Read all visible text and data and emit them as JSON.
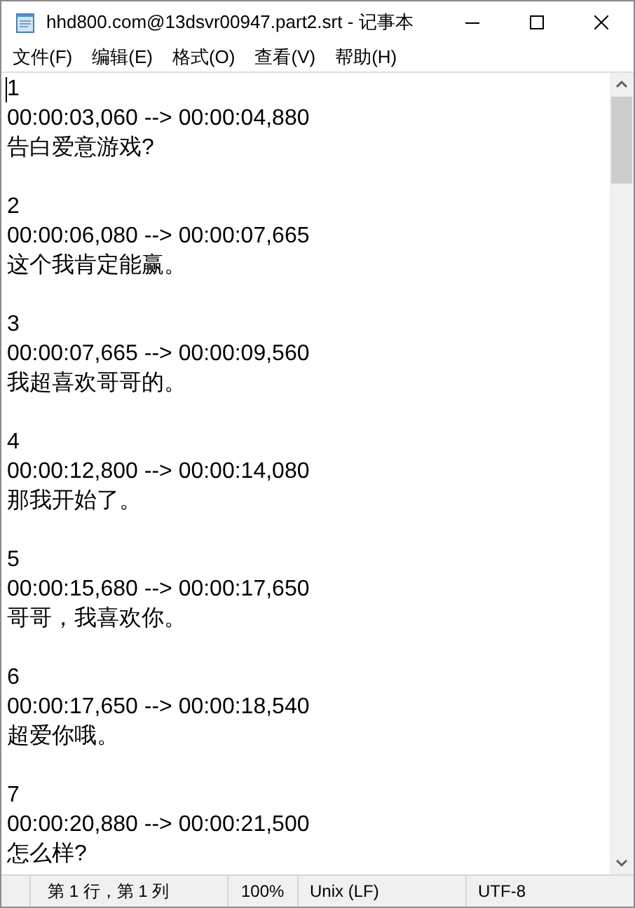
{
  "window": {
    "title": "hhd800.com@13dsvr00947.part2.srt - 记事本"
  },
  "menu": [
    "文件(F)",
    "编辑(E)",
    "格式(O)",
    "查看(V)",
    "帮助(H)"
  ],
  "subtitles": [
    {
      "index": "1",
      "time": "00:00:03,060 --> 00:00:04,880",
      "text": "告白爱意游戏?"
    },
    {
      "index": "2",
      "time": "00:00:06,080 --> 00:00:07,665",
      "text": "这个我肯定能赢。"
    },
    {
      "index": "3",
      "time": "00:00:07,665 --> 00:00:09,560",
      "text": "我超喜欢哥哥的。"
    },
    {
      "index": "4",
      "time": "00:00:12,800 --> 00:00:14,080",
      "text": "那我开始了。"
    },
    {
      "index": "5",
      "time": "00:00:15,680 --> 00:00:17,650",
      "text": "哥哥，我喜欢你。"
    },
    {
      "index": "6",
      "time": "00:00:17,650 --> 00:00:18,540",
      "text": "超爱你哦。"
    },
    {
      "index": "7",
      "time": "00:00:20,880 --> 00:00:21,500",
      "text": "怎么样?"
    }
  ],
  "status_bar": {
    "position": "第 1 行，第 1 列",
    "zoom": "100%",
    "line_ending": "Unix (LF)",
    "encoding": "UTF-8"
  }
}
